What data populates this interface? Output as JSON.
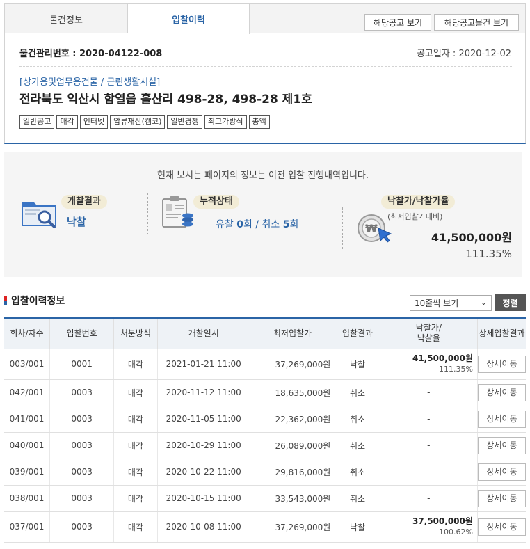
{
  "tabs": [
    {
      "label": "물건정보",
      "active": false
    },
    {
      "label": "입찰이력",
      "active": true
    }
  ],
  "top_buttons": {
    "notice": "해당공고 보기",
    "notice_items": "해당공고물건 보기"
  },
  "property": {
    "mgmt_label": "물건관리번호 : 2020-04122-008",
    "notice_date_label": "공고일자 : 2020-12-02",
    "category": "[상가용및업무용건물 / 근린생활시설]",
    "address": "전라북도 익산시 함열읍 흘산리 498-28, 498-28 제1호",
    "tags": [
      "일반공고",
      "매각",
      "인터넷",
      "압류재산(캠코)",
      "일반경쟁",
      "최고가방식",
      "총액"
    ]
  },
  "summary": {
    "message": "현재 보시는 페이지의 정보는 이전 입찰 진행내역입니다.",
    "result_label": "개찰결과",
    "result_value": "낙찰",
    "status_label": "누적상태",
    "fail_label": "유찰",
    "fail_count": "0",
    "cancel_label": "취소",
    "cancel_count": "5",
    "times_unit": "회",
    "price_label": "낙찰가/낙찰가율",
    "price_sub": "(최저입찰가대비)",
    "price_value": "41,500,000원",
    "price_rate": "111.35%"
  },
  "list": {
    "title": "입찰이력정보",
    "page_size": "10줄씩 보기",
    "sort_label": "정렬",
    "headers": [
      "회차/자수",
      "입찰번호",
      "처분방식",
      "개찰일시",
      "최저입찰가",
      "입찰결과",
      "낙찰가/\n낙찰율",
      "상세입찰결과"
    ],
    "detail_label": "상세이동",
    "rows": [
      {
        "round": "003/001",
        "bid_no": "0001",
        "method": "매각",
        "date": "2021-01-21 11:00",
        "min_price": "37,269,000원",
        "result": "낙찰",
        "win_price": "41,500,000원",
        "win_rate": "111.35%"
      },
      {
        "round": "042/001",
        "bid_no": "0003",
        "method": "매각",
        "date": "2020-11-12 11:00",
        "min_price": "18,635,000원",
        "result": "취소",
        "win_price": "-",
        "win_rate": ""
      },
      {
        "round": "041/001",
        "bid_no": "0003",
        "method": "매각",
        "date": "2020-11-05 11:00",
        "min_price": "22,362,000원",
        "result": "취소",
        "win_price": "-",
        "win_rate": ""
      },
      {
        "round": "040/001",
        "bid_no": "0003",
        "method": "매각",
        "date": "2020-10-29 11:00",
        "min_price": "26,089,000원",
        "result": "취소",
        "win_price": "-",
        "win_rate": ""
      },
      {
        "round": "039/001",
        "bid_no": "0003",
        "method": "매각",
        "date": "2020-10-22 11:00",
        "min_price": "29,816,000원",
        "result": "취소",
        "win_price": "-",
        "win_rate": ""
      },
      {
        "round": "038/001",
        "bid_no": "0003",
        "method": "매각",
        "date": "2020-10-15 11:00",
        "min_price": "33,543,000원",
        "result": "취소",
        "win_price": "-",
        "win_rate": ""
      },
      {
        "round": "037/001",
        "bid_no": "0003",
        "method": "매각",
        "date": "2020-10-08 11:00",
        "min_price": "37,269,000원",
        "result": "낙찰",
        "win_price": "37,500,000원",
        "win_rate": "100.62%"
      }
    ]
  },
  "colors": {
    "accent": "#2a64a6",
    "badge": "#f2ecd6",
    "header_bg": "#eef2f6"
  },
  "icons": [
    "folder-search-icon",
    "clipboard-coins-icon",
    "won-coin-cursor-icon",
    "chevron-down-icon"
  ]
}
